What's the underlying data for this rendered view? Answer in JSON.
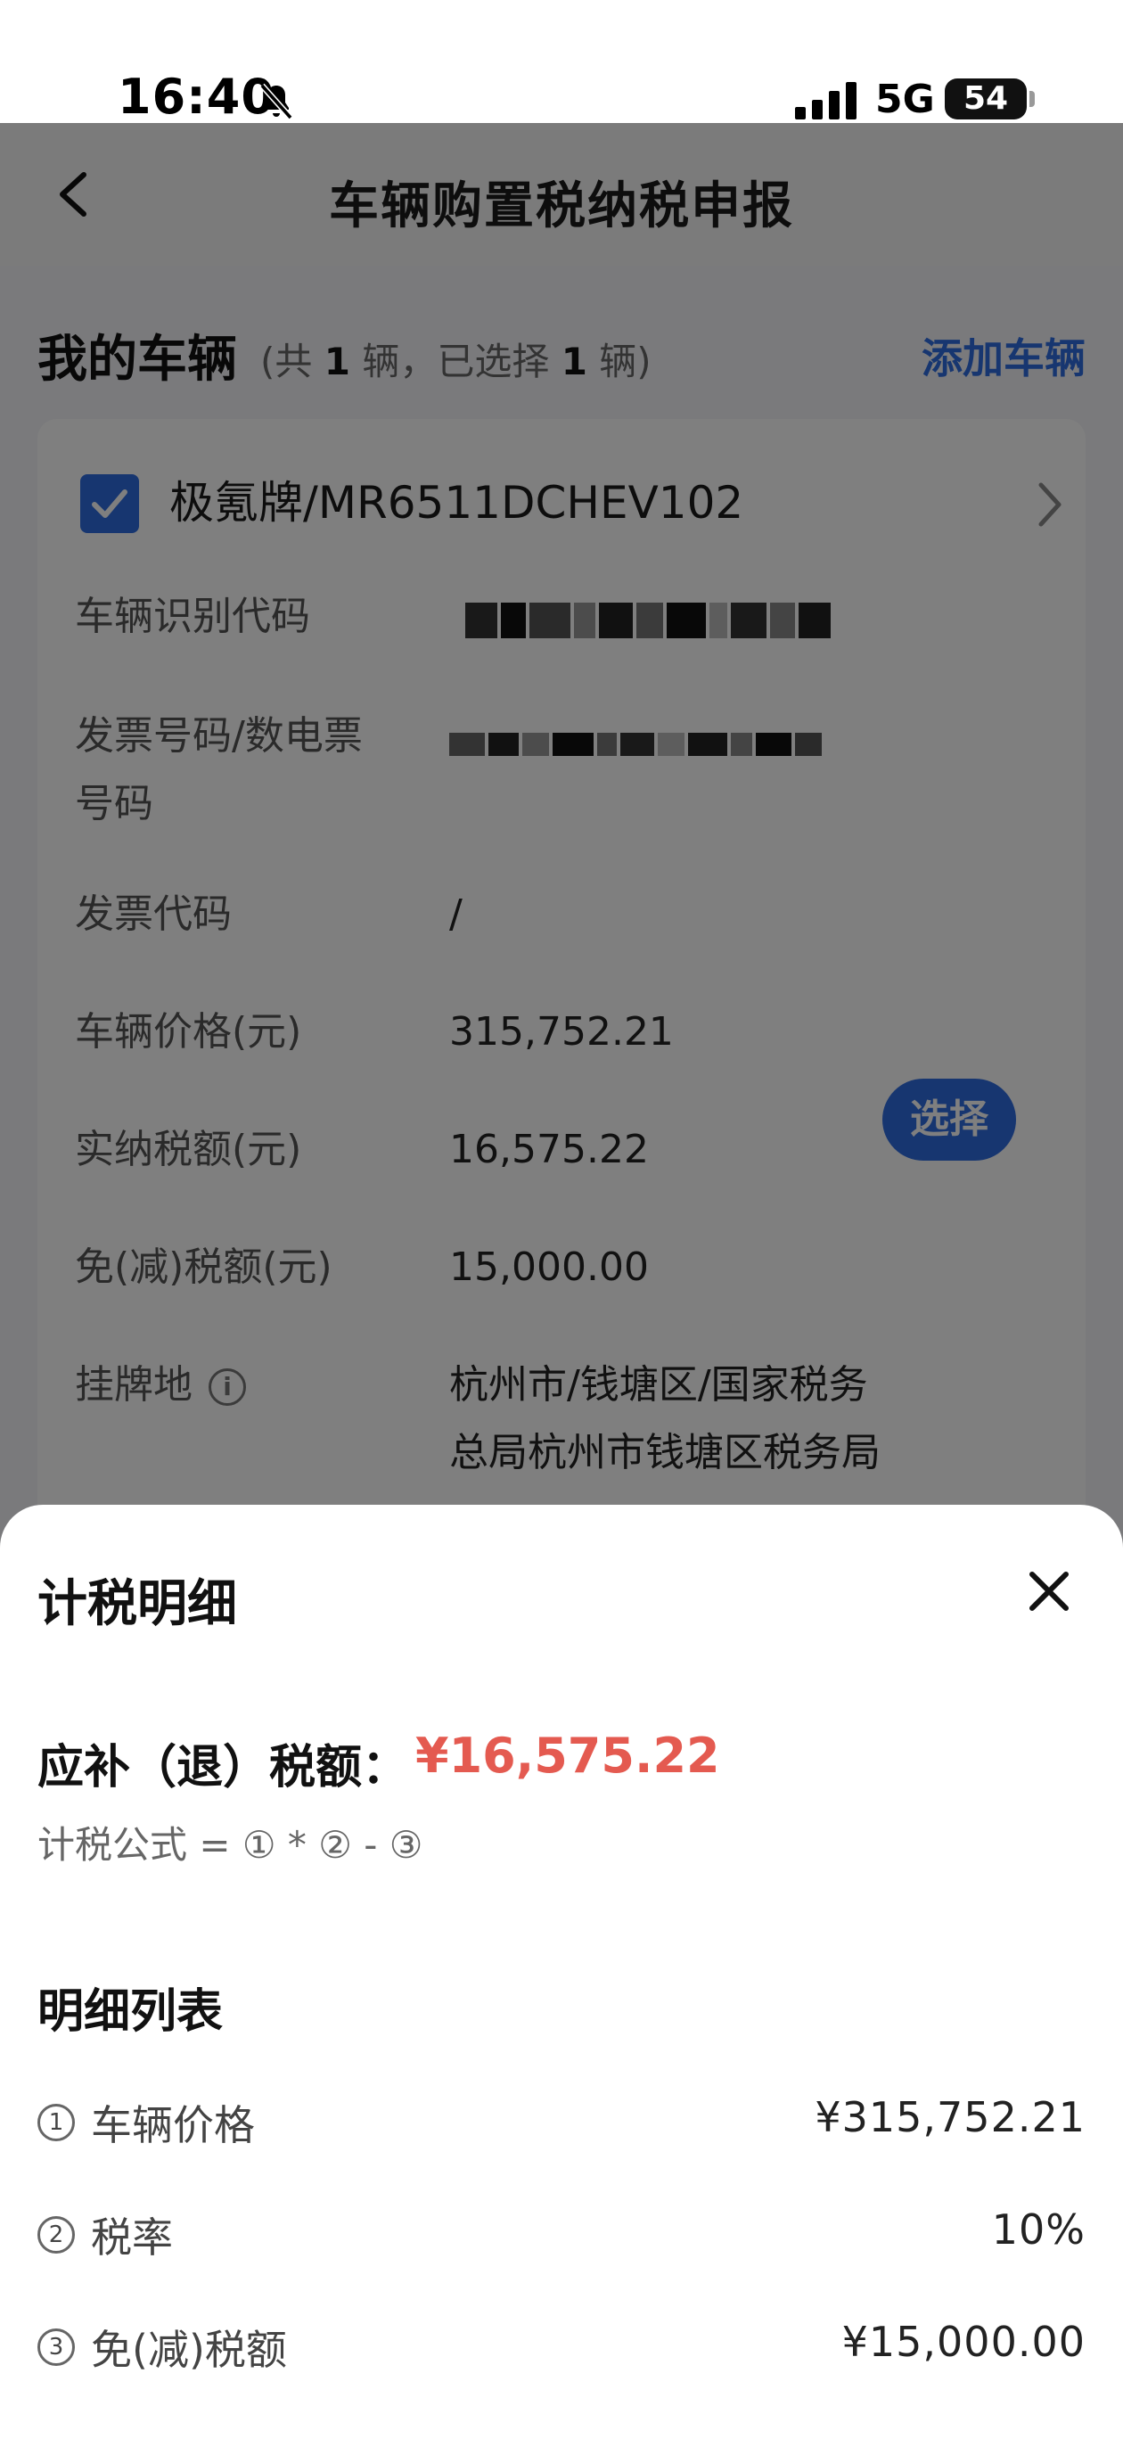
{
  "status": {
    "time": "16:40",
    "network": "5G",
    "battery": "54",
    "icons": [
      "bell-muted-icon",
      "signal-icon",
      "battery-icon"
    ]
  },
  "nav": {
    "title": "车辆购置税纳税申报",
    "back_icon": "chevron-left-icon"
  },
  "vehicles": {
    "title": "我的车辆",
    "count_prefix": "(共 ",
    "count_total": "1",
    "count_mid": " 辆，已选择 ",
    "count_selected": "1",
    "count_suffix": " 辆)",
    "add_label": "添加车辆"
  },
  "card": {
    "model": "极氪牌/MR6511DCHEV102",
    "rows": [
      {
        "label": "车辆识别代码",
        "value": ""
      },
      {
        "label_line1": "发票号码/数电票",
        "label_line2": "号码",
        "value": ""
      },
      {
        "label": "发票代码",
        "value": "/"
      },
      {
        "label": "车辆价格(元)",
        "value": "315,752.21"
      },
      {
        "label": "实纳税额(元)",
        "value": "16,575.22"
      },
      {
        "label": "免(减)税额(元)",
        "value": "15,000.00"
      },
      {
        "label": "挂牌地",
        "value_line1": "杭州市/钱塘区/国家税务",
        "value_line2": "总局杭州市钱塘区税务局"
      }
    ],
    "select_label": "选择",
    "info_glyph": "i"
  },
  "sheet": {
    "title": "计税明细",
    "due_label": "应补（退）税额：",
    "due_amount": "¥16,575.22",
    "formula": "计税公式 = ① * ② - ③",
    "list_title": "明细列表",
    "items": [
      {
        "num": "1",
        "label": "车辆价格",
        "value": "¥315,752.21"
      },
      {
        "num": "2",
        "label": "税率",
        "value": "10%"
      },
      {
        "num": "3",
        "label": "免(减)税额",
        "value": "¥15,000.00"
      }
    ]
  },
  "colors": {
    "accent": "#2f6de1",
    "amount_red": "#e45a50",
    "overlay": "rgba(0,0,0,0.5)"
  }
}
